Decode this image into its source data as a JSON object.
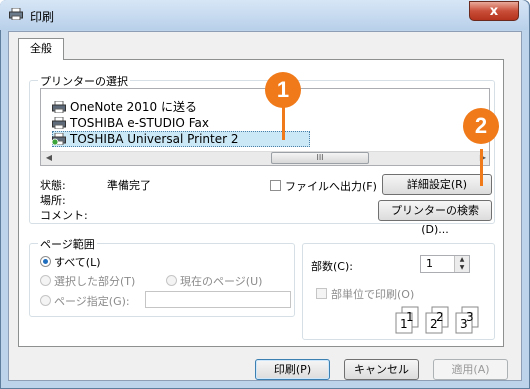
{
  "window": {
    "title": "印刷",
    "close_label": "x"
  },
  "tabs": [
    {
      "label": "全般"
    }
  ],
  "printer_section": {
    "label": "プリンターの選択",
    "printers": [
      {
        "name": "OneNote 2010 に送る"
      },
      {
        "name": "TOSHIBA e-STUDIO Fax"
      },
      {
        "name": "TOSHIBA Universal Printer 2",
        "selected": true
      }
    ],
    "scroll_thumb_glyph": "III",
    "status_label": "状態:",
    "status_value": "準備完了",
    "location_label": "場所:",
    "comment_label": "コメント:",
    "print_to_file_label": "ファイルへ出力(F)",
    "preferences_button": "詳細設定(R)",
    "find_printer_button": "プリンターの検索(D)..."
  },
  "page_range": {
    "label": "ページ範囲",
    "all_label": "すべて(L)",
    "selection_label": "選択した部分(T)",
    "current_page_label": "現在のページ(U)",
    "pages_label": "ページ指定(G):",
    "pages_value": ""
  },
  "copies": {
    "label": "部数(C):",
    "value": "1",
    "collate_label": "部単位で印刷(O)",
    "collate_pages": [
      "1",
      "1",
      "2",
      "2",
      "3",
      "3"
    ]
  },
  "footer": {
    "print_button": "印刷(P)",
    "cancel_button": "キャンセル",
    "apply_button": "適用(A)"
  },
  "callouts": [
    {
      "number": "1"
    },
    {
      "number": "2"
    }
  ],
  "colors": {
    "callout": "#f07a1a",
    "selection": "#cbe8f6",
    "close": "#c94e39"
  }
}
